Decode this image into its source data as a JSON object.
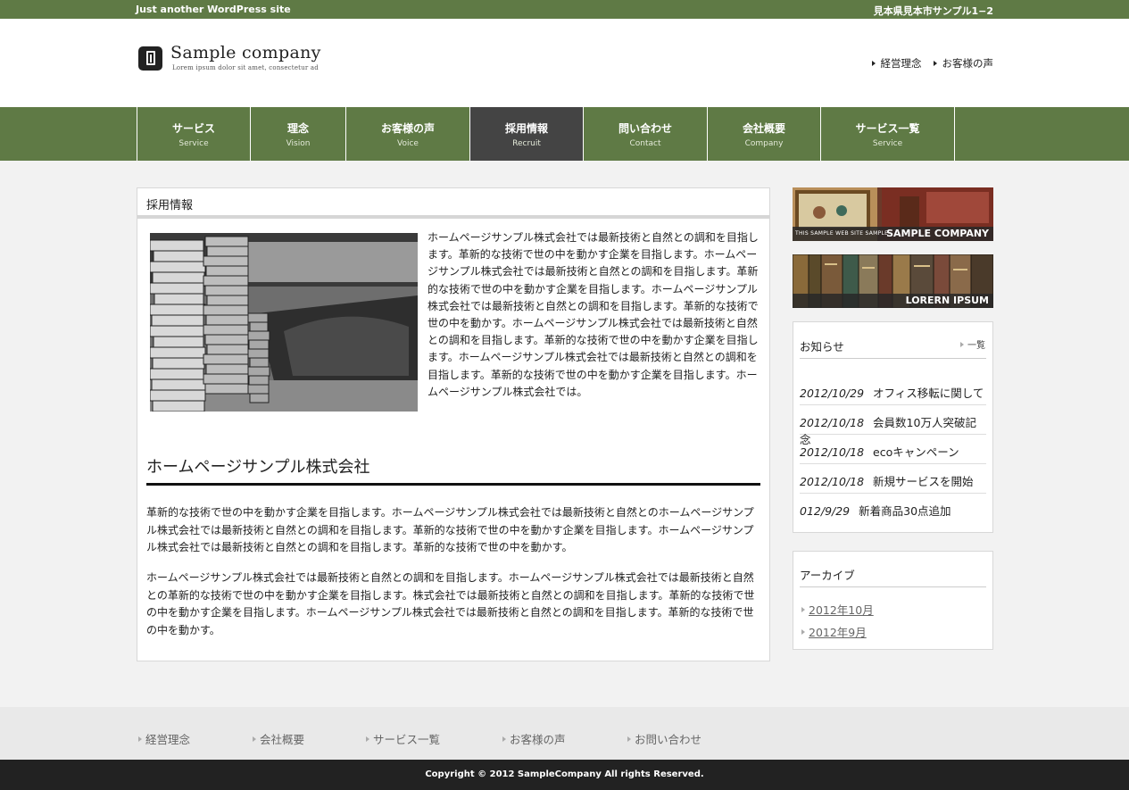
{
  "topbar": {
    "tagline": "Just another WordPress site",
    "address": "見本県見本市サンプル1−2"
  },
  "header": {
    "brand": "Sample company",
    "brand_sub": "Lorem ipsum dolor sit amet, consectetur ad",
    "links": [
      "経営理念",
      "お客様の声"
    ]
  },
  "nav": [
    {
      "jp": "サービス",
      "en": "Service"
    },
    {
      "jp": "理念",
      "en": "Vision"
    },
    {
      "jp": "お客様の声",
      "en": "Voice"
    },
    {
      "jp": "採用情報",
      "en": "Recruit"
    },
    {
      "jp": "問い合わせ",
      "en": "Contact"
    },
    {
      "jp": "会社概要",
      "en": "Company"
    },
    {
      "jp": "サービス一覧",
      "en": "Service"
    }
  ],
  "main": {
    "title": "採用情報",
    "intro": "ホームページサンプル株式会社では最新技術と自然との調和を目指します。革新的な技術で世の中を動かす企業を目指します。ホームページサンプル株式会社では最新技術と自然との調和を目指します。革新的な技術で世の中を動かす企業を目指します。ホームページサンプル株式会社では最新技術と自然との調和を目指します。革新的な技術で世の中を動かす。ホームページサンプル株式会社では最新技術と自然との調和を目指します。革新的な技術で世の中を動かす企業を目指します。ホームページサンプル株式会社では最新技術と自然との調和を目指します。革新的な技術で世の中を動かす企業を目指します。ホームページサンプル株式会社では。",
    "heading": "ホームページサンプル株式会社",
    "para1": "革新的な技術で世の中を動かす企業を目指します。ホームページサンプル株式会社では最新技術と自然とのホームページサンプル株式会社では最新技術と自然との調和を目指します。革新的な技術で世の中を動かす企業を目指します。ホームページサンプル株式会社では最新技術と自然との調和を目指します。革新的な技術で世の中を動かす。",
    "para2": "ホームページサンプル株式会社では最新技術と自然との調和を目指します。ホームページサンプル株式会社では最新技術と自然との革新的な技術で世の中を動かす企業を目指します。株式会社では最新技術と自然との調和を目指します。革新的な技術で世の中を動かす企業を目指します。ホームページサンプル株式会社では最新技術と自然との調和を目指します。革新的な技術で世の中を動かす。"
  },
  "sidebar": {
    "banner1": {
      "small": "THIS SAMPLE WEB SITE SAMPLE",
      "big": "SAMPLE COMPANY"
    },
    "banner2": {
      "big": "LORERN IPSUM"
    },
    "news": {
      "title": "お知らせ",
      "more": "一覧",
      "items": [
        {
          "date": "2012/10/29",
          "text": "オフィス移転に関して"
        },
        {
          "date": "2012/10/18",
          "text": "会員数10万人突破記念"
        },
        {
          "date": "2012/10/18",
          "text": "ecoキャンペーン"
        },
        {
          "date": "2012/10/18",
          "text": "新規サービスを開始"
        },
        {
          "date": "012/9/29",
          "text": "新着商品30点追加"
        }
      ]
    },
    "archive": {
      "title": "アーカイブ",
      "items": [
        "2012年10月",
        "2012年9月"
      ]
    }
  },
  "footer": {
    "links": [
      "経営理念",
      "会社概要",
      "サービス一覧",
      "お客様の声",
      "お問い合わせ"
    ],
    "copyright": "Copyright © 2012 SampleCompany All rights Reserved."
  }
}
